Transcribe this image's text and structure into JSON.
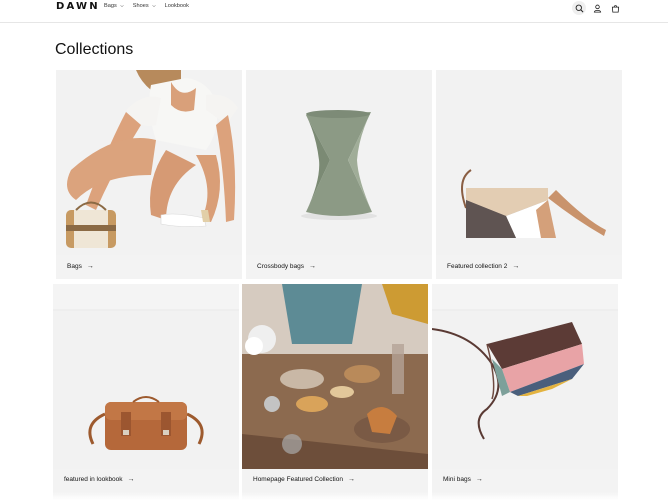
{
  "header": {
    "logo": "DAWN",
    "nav": [
      {
        "label": "Bags",
        "has_dropdown": true
      },
      {
        "label": "Shoes",
        "has_dropdown": true
      },
      {
        "label": "Lookbook",
        "has_dropdown": false
      }
    ],
    "icons": [
      "search-icon",
      "account-icon",
      "cart-icon"
    ]
  },
  "page": {
    "title": "Collections"
  },
  "collections": [
    {
      "label": "Bags",
      "image": "woman crouching holding a white-and-tan handbag"
    },
    {
      "label": "Crossbody bags",
      "image": "sage green twisted geometric vase"
    },
    {
      "label": "Featured collection 2",
      "image": "tan and grey geometric crossbody bag"
    },
    {
      "label": "featured in lookbook",
      "image": "brown leather satchel bag"
    },
    {
      "label": "Homepage Featured Collection",
      "image": "dinner table with food and plates"
    },
    {
      "label": "Mini bags",
      "image": "multicolor folding mini bag with strap"
    }
  ],
  "colors": {
    "card_bg": "#f3f3f3",
    "text": "#121212",
    "border": "#e6e6e6"
  }
}
